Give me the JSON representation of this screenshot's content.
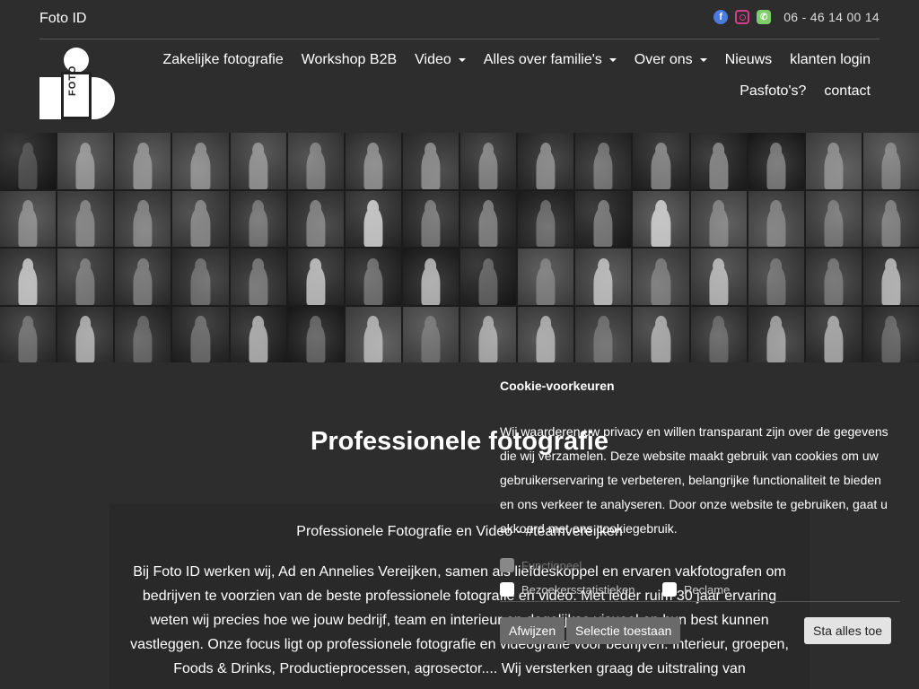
{
  "header": {
    "brand_text": "Foto ID",
    "phone": "06 - 46 14 00 14",
    "social_icons": [
      "facebook-icon",
      "instagram-icon",
      "phone-icon"
    ],
    "logo_text": "FOTO"
  },
  "nav": {
    "items": [
      {
        "label": "Zakelijke fotografie",
        "dropdown": false
      },
      {
        "label": "Workshop B2B",
        "dropdown": false
      },
      {
        "label": "Video",
        "dropdown": true
      },
      {
        "label": "Alles over familie's",
        "dropdown": true
      },
      {
        "label": "Over ons",
        "dropdown": true
      },
      {
        "label": "Nieuws",
        "dropdown": false
      },
      {
        "label": "klanten login",
        "dropdown": false
      },
      {
        "label": "Pasfoto's?",
        "dropdown": false
      },
      {
        "label": "contact",
        "dropdown": false
      }
    ]
  },
  "gallery": {
    "rows": 4,
    "columns": 16
  },
  "main": {
    "title": "Professionele fotografie",
    "subtitle": "Professionele Fotografie en Video  - #teamvereijken",
    "paragraph": "Bij Foto ID werken wij, Ad en Annelies Vereijken, samen als liefdeskoppel en ervaren vakfotografen om bedrijven te voorzien van de beste professionele fotografie en video. Met ieder ruim 30 jaar ervaring weten wij precies hoe we jouw bedrijf, team en interieur en dagelijkse visueel op hun best kunnen vastleggen. Onze focus ligt op professionele fotografie en videografie voor bedrijven: Interieur, groepen, Foods & Drinks, Productieprocessen, agrosector....  Wij versterken graag de uitstraling van"
  },
  "cookie": {
    "title": "Cookie-voorkeuren",
    "text": "Wij waarderen uw privacy en willen transparant zijn over de gegevens die wij verzamelen. Deze website maakt gebruik van cookies om uw gebruikerservaring te verbeteren, belangrijke functionaliteit te bieden en ons verkeer te analyseren. Door onze website te gebruiken, gaat u akkoord met ons cookiegebruik.",
    "options": {
      "functional": "Functioneel",
      "statistics": "Bezoekersstatistieken",
      "ads": "Reclame"
    },
    "buttons": {
      "reject": "Afwijzen",
      "selection": "Selectie toestaan",
      "accept_all": "Sta alles toe"
    }
  }
}
